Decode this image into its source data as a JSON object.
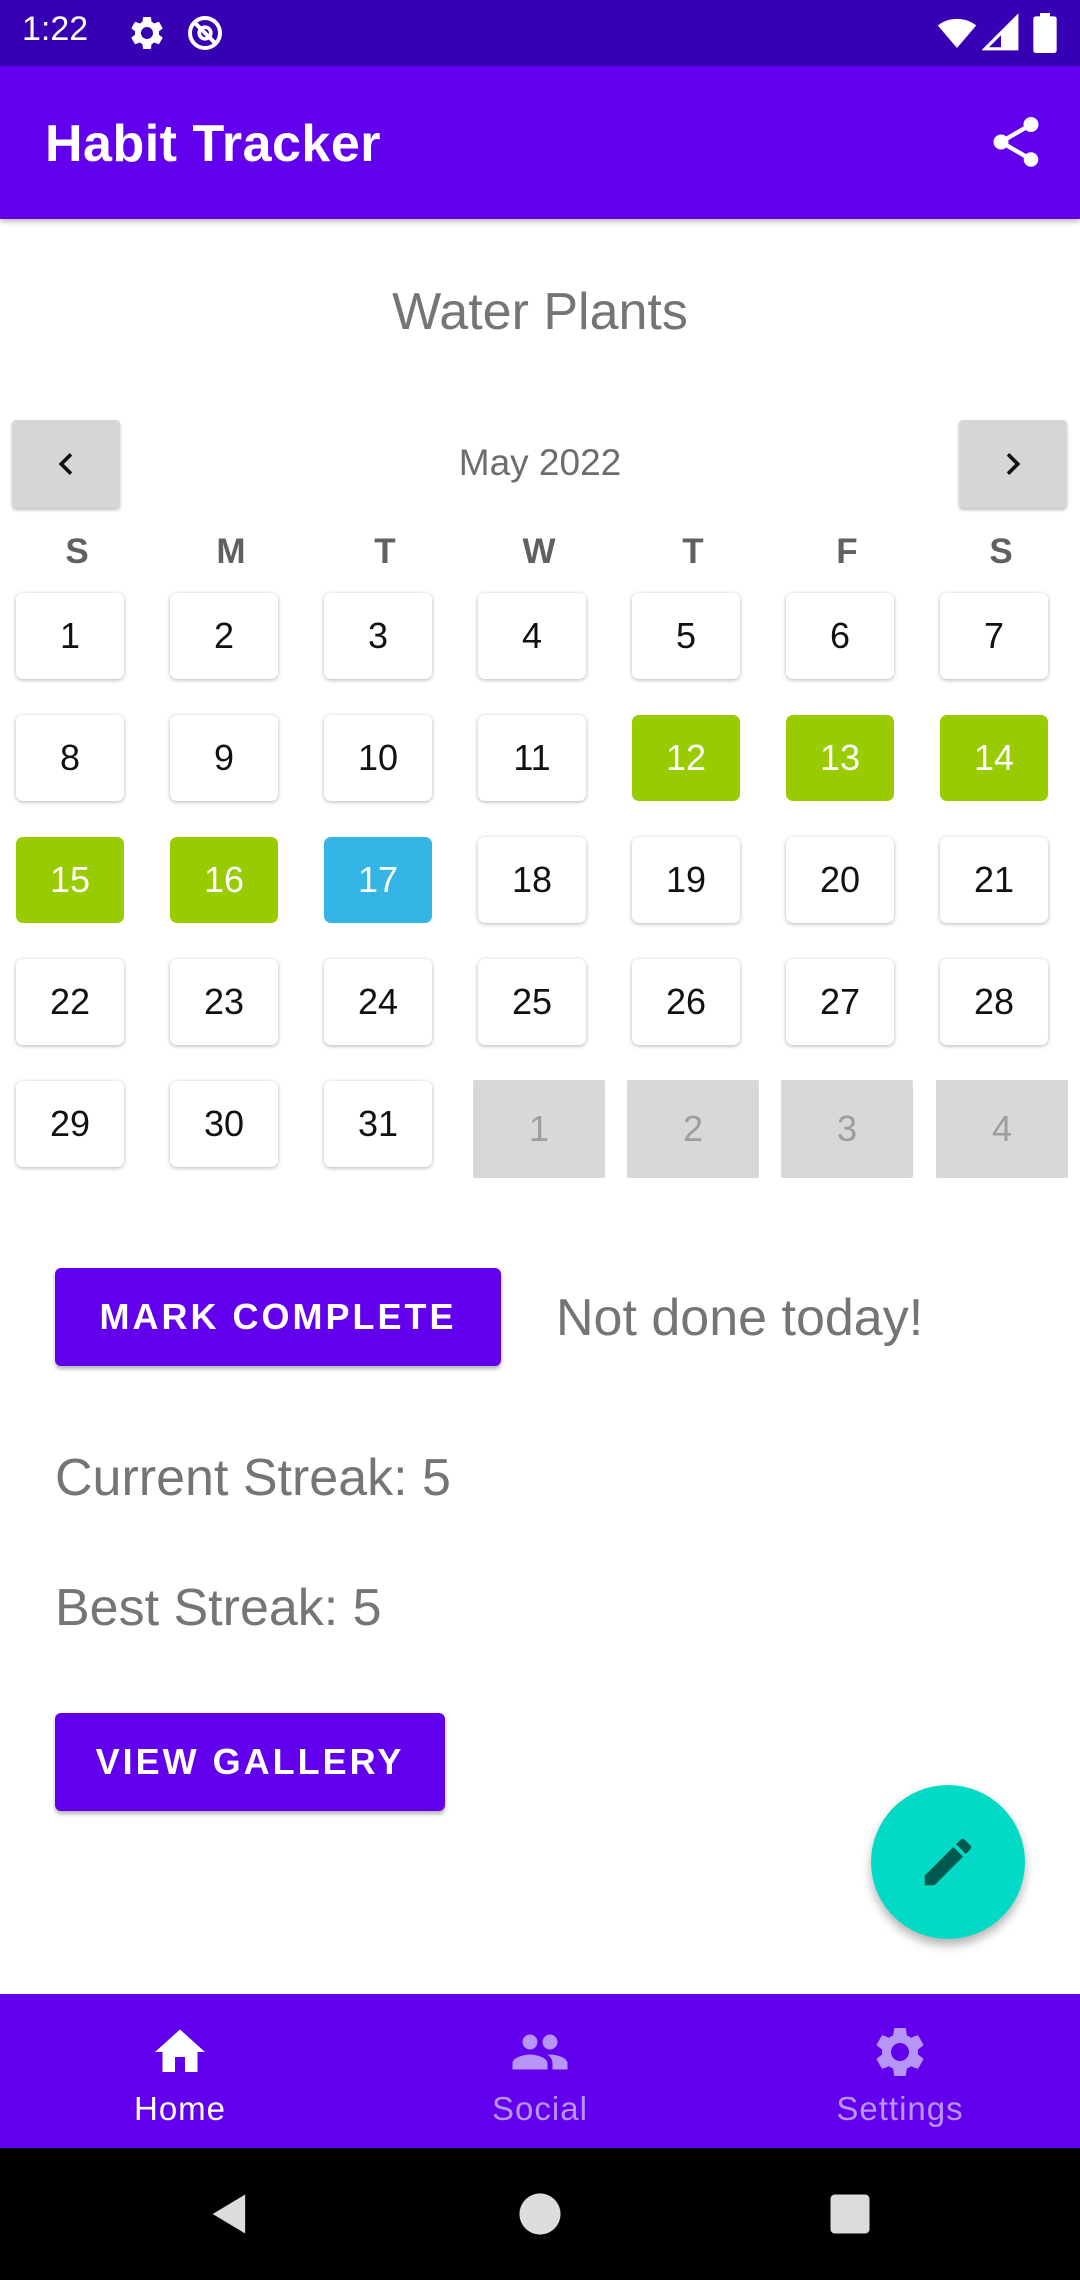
{
  "status_bar": {
    "time": "1:22"
  },
  "app_bar": {
    "title": "Habit Tracker"
  },
  "habit": {
    "name": "Water Plants"
  },
  "calendar": {
    "month": "May 2022",
    "weekdays": [
      "S",
      "M",
      "T",
      "W",
      "T",
      "F",
      "S"
    ],
    "weeks": [
      [
        {
          "d": "1",
          "s": ""
        },
        {
          "d": "2",
          "s": ""
        },
        {
          "d": "3",
          "s": ""
        },
        {
          "d": "4",
          "s": ""
        },
        {
          "d": "5",
          "s": ""
        },
        {
          "d": "6",
          "s": ""
        },
        {
          "d": "7",
          "s": ""
        }
      ],
      [
        {
          "d": "8",
          "s": ""
        },
        {
          "d": "9",
          "s": ""
        },
        {
          "d": "10",
          "s": ""
        },
        {
          "d": "11",
          "s": ""
        },
        {
          "d": "12",
          "s": "done"
        },
        {
          "d": "13",
          "s": "done"
        },
        {
          "d": "14",
          "s": "done"
        }
      ],
      [
        {
          "d": "15",
          "s": "done"
        },
        {
          "d": "16",
          "s": "done"
        },
        {
          "d": "17",
          "s": "today"
        },
        {
          "d": "18",
          "s": ""
        },
        {
          "d": "19",
          "s": ""
        },
        {
          "d": "20",
          "s": ""
        },
        {
          "d": "21",
          "s": ""
        }
      ],
      [
        {
          "d": "22",
          "s": ""
        },
        {
          "d": "23",
          "s": ""
        },
        {
          "d": "24",
          "s": ""
        },
        {
          "d": "25",
          "s": ""
        },
        {
          "d": "26",
          "s": ""
        },
        {
          "d": "27",
          "s": ""
        },
        {
          "d": "28",
          "s": ""
        }
      ],
      [
        {
          "d": "29",
          "s": ""
        },
        {
          "d": "30",
          "s": ""
        },
        {
          "d": "31",
          "s": ""
        },
        {
          "d": "1",
          "s": "other"
        },
        {
          "d": "2",
          "s": "other"
        },
        {
          "d": "3",
          "s": "other"
        },
        {
          "d": "4",
          "s": "other"
        }
      ]
    ],
    "colors": {
      "completed": "#99cc00",
      "today": "#33b5e5",
      "other_month": "#d8d8d8"
    }
  },
  "actions": {
    "mark_complete_label": "MARK COMPLETE",
    "today_status": "Not done today!",
    "view_gallery_label": "VIEW GALLERY"
  },
  "stats": {
    "current_streak": "Current Streak: 5",
    "best_streak": "Best Streak: 5"
  },
  "fab": {
    "icon": "pencil-icon"
  },
  "bottom_nav": {
    "items": [
      {
        "label": "Home",
        "icon": "home-icon",
        "selected": true
      },
      {
        "label": "Social",
        "icon": "people-icon",
        "selected": false
      },
      {
        "label": "Settings",
        "icon": "gear-icon",
        "selected": false
      }
    ]
  },
  "theme": {
    "primary": "#6200ee",
    "primary_dark": "#3700b3",
    "accent": "#03dac5"
  }
}
